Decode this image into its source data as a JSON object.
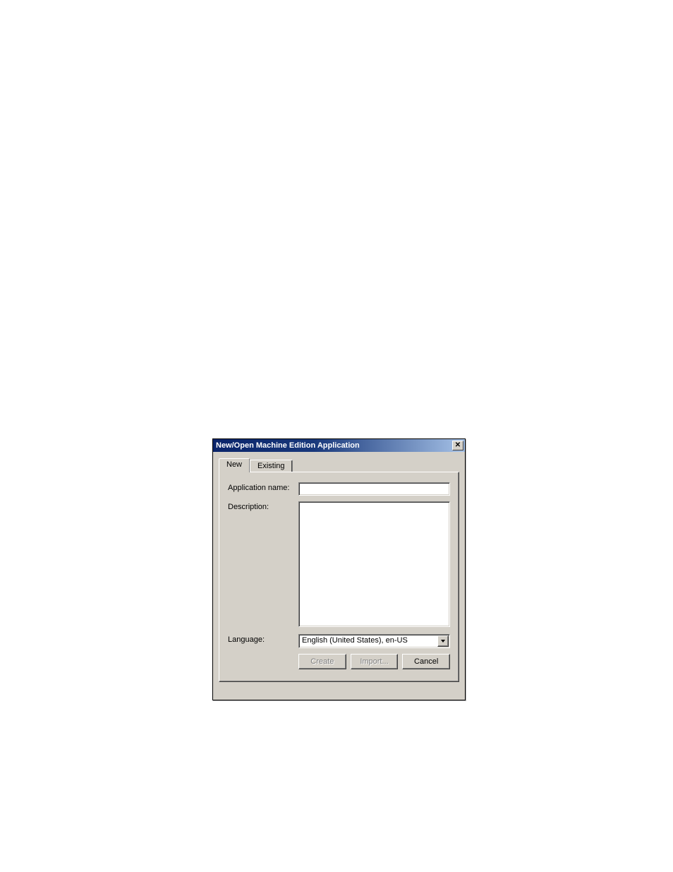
{
  "dialog": {
    "title": "New/Open Machine Edition Application",
    "tabs": [
      {
        "label": "New",
        "active": true
      },
      {
        "label": "Existing",
        "active": false
      }
    ],
    "form": {
      "app_name_label": "Application name:",
      "app_name_value": "",
      "description_label": "Description:",
      "description_value": "",
      "language_label": "Language:",
      "language_value": "English (United States), en-US"
    },
    "buttons": {
      "create": "Create",
      "import": "Import...",
      "cancel": "Cancel"
    }
  }
}
